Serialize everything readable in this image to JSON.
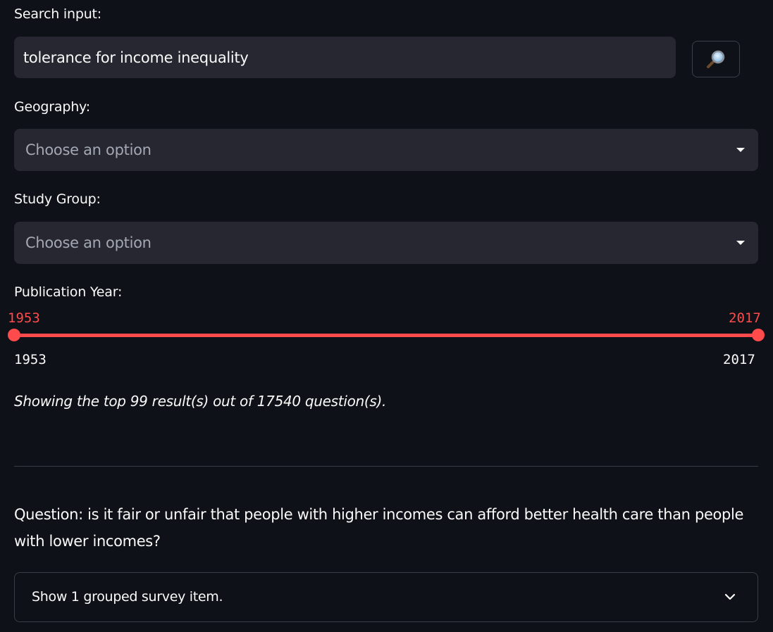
{
  "search": {
    "label": "Search input:",
    "value": "tolerance for income inequality",
    "button_icon": "magnifier-icon"
  },
  "geography": {
    "label": "Geography:",
    "placeholder": "Choose an option"
  },
  "study_group": {
    "label": "Study Group:",
    "placeholder": "Choose an option"
  },
  "publication_year": {
    "label": "Publication Year:",
    "selected_min": "1953",
    "selected_max": "2017",
    "range_min": "1953",
    "range_max": "2017",
    "accent_color": "#ff4b4b"
  },
  "results": {
    "summary": "Showing the top 99 result(s) out of 17540 question(s)."
  },
  "question": {
    "text": "Question: is it fair or unfair that people with higher incomes can afford better health care than people with lower incomes?"
  },
  "expander": {
    "label": "Show 1 grouped survey item.",
    "icon": "chevron-down-icon"
  },
  "colors": {
    "background": "#0e1117",
    "input_background": "#262730",
    "text": "#fafafa",
    "placeholder": "#a3a8b4",
    "accent": "#ff4b4b"
  }
}
